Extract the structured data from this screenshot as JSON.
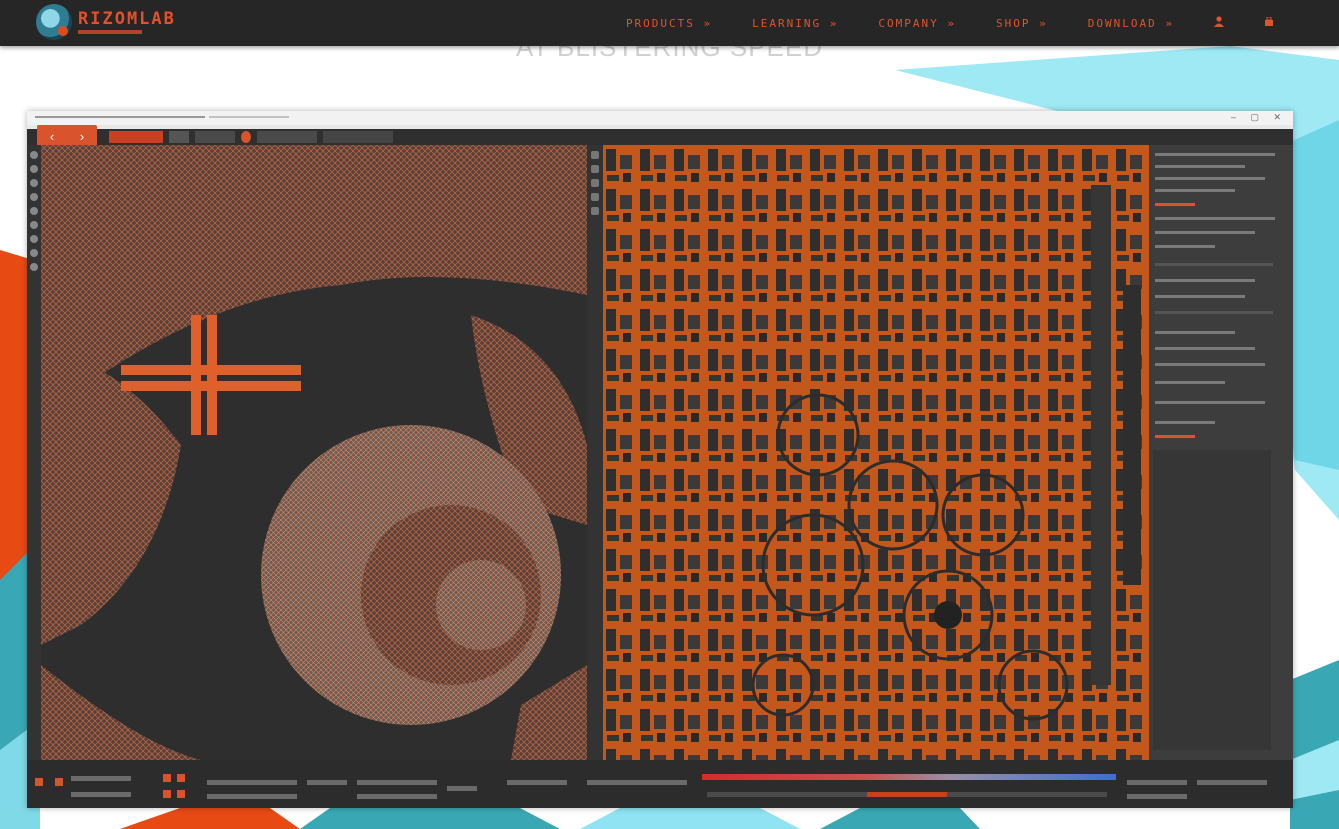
{
  "colors": {
    "accent": "#e0532b",
    "nav_bg": "#262626",
    "bg_cyan": "#8fe3f2",
    "bg_teal": "#3aa8b4",
    "bg_orange": "#e84a14",
    "uv_orange": "#c55a1e",
    "app_bg": "#3b3b3b"
  },
  "header": {
    "logo": {
      "name": "RIZOMLAB"
    },
    "nav": [
      {
        "label": "PRODUCTS »"
      },
      {
        "label": "LEARNING »"
      },
      {
        "label": "COMPANY »"
      },
      {
        "label": "SHOP »"
      },
      {
        "label": "DOWNLOAD »"
      }
    ],
    "icons": [
      "user-icon",
      "cart-icon"
    ]
  },
  "hero": {
    "text": "AT BLISTERING SPEED"
  },
  "app": {
    "toolbar": {
      "back_icon": "arrow-left-icon",
      "forward_icon": "arrow-right-icon"
    },
    "viewports": [
      "3d-viewport",
      "uv-viewport"
    ]
  }
}
